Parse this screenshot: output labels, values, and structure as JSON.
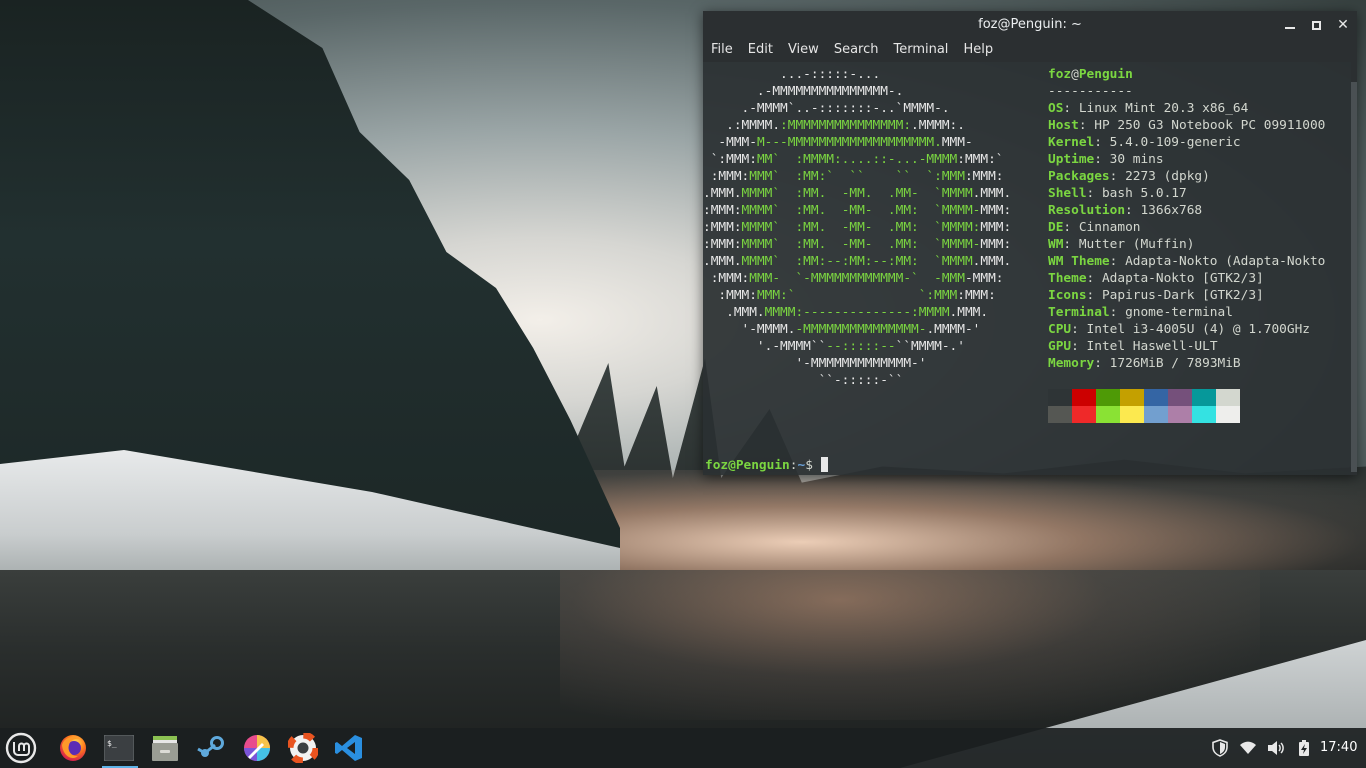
{
  "window": {
    "title": "foz@Penguin: ~",
    "menu": [
      "File",
      "Edit",
      "View",
      "Search",
      "Terminal",
      "Help"
    ]
  },
  "neofetch": {
    "header_user": "foz",
    "header_at": "@",
    "header_host": "Penguin",
    "separator": "-----------",
    "logo_lines": [
      [
        [
          "w",
          "          ...-:::::-..."
        ]
      ],
      [
        [
          "w",
          "       .-MMMMMMMMMMMMMMM-."
        ]
      ],
      [
        [
          "w",
          "     .-MMMM`..-:::::::-..`MMMM-."
        ]
      ],
      [
        [
          "w",
          "   .:MMMM."
        ],
        [
          "g",
          ":MMMMMMMMMMMMMMM:"
        ],
        [
          "w",
          ".MMMM:."
        ]
      ],
      [
        [
          "w",
          "  -MMM-"
        ],
        [
          "g",
          "M---MMMMMMMMMMMMMMMMMMM."
        ],
        [
          "w",
          "MMM-"
        ]
      ],
      [
        [
          "w",
          " `:MMM:"
        ],
        [
          "g",
          "MM`  :MMMM:....::-...-MMMM"
        ],
        [
          "w",
          ":MMM:`"
        ]
      ],
      [
        [
          "w",
          " :MMM:"
        ],
        [
          "g",
          "MMM`  :MM:`  ``    ``  `:MMM"
        ],
        [
          "w",
          ":MMM:"
        ]
      ],
      [
        [
          "w",
          ".MMM."
        ],
        [
          "g",
          "MMMM`  :MM.  -MM.  .MM-  `MMMM"
        ],
        [
          "w",
          ".MMM."
        ]
      ],
      [
        [
          "w",
          ":MMM:"
        ],
        [
          "g",
          "MMMM`  :MM.  -MM-  .MM:  `MMMM-"
        ],
        [
          "w",
          "MMM:"
        ]
      ],
      [
        [
          "w",
          ":MMM:"
        ],
        [
          "g",
          "MMMM`  :MM.  -MM-  .MM:  `MMMM:"
        ],
        [
          "w",
          "MMM:"
        ]
      ],
      [
        [
          "w",
          ":MMM:"
        ],
        [
          "g",
          "MMMM`  :MM.  -MM-  .MM:  `MMMM-"
        ],
        [
          "w",
          "MMM:"
        ]
      ],
      [
        [
          "w",
          ".MMM."
        ],
        [
          "g",
          "MMMM`  :MM:--:MM:--:MM:  `MMMM"
        ],
        [
          "w",
          ".MMM."
        ]
      ],
      [
        [
          "w",
          " :MMM:"
        ],
        [
          "g",
          "MMM-  `-MMMMMMMMMMMM-`  -MMM"
        ],
        [
          "w",
          "-MMM:"
        ]
      ],
      [
        [
          "w",
          "  :MMM:"
        ],
        [
          "g",
          "MMM:`                `:MMM"
        ],
        [
          "w",
          ":MMM:"
        ]
      ],
      [
        [
          "w",
          "   .MMM."
        ],
        [
          "g",
          "MMMM:--------------:MMMM"
        ],
        [
          "w",
          ".MMM."
        ]
      ],
      [
        [
          "w",
          "     '-MMMM."
        ],
        [
          "g",
          "-MMMMMMMMMMMMMMM-"
        ],
        [
          "w",
          ".MMMM-'"
        ]
      ],
      [
        [
          "w",
          "       '.-MMMM``"
        ],
        [
          "g",
          "--:::::--"
        ],
        [
          "w",
          "``MMMM-.'"
        ]
      ],
      [
        [
          "w",
          "            '-MMMMMMMMMMMMM-'"
        ]
      ],
      [
        [
          "w",
          "               ``-:::::-``"
        ]
      ]
    ],
    "info": [
      {
        "key": "OS",
        "value": "Linux Mint 20.3 x86_64"
      },
      {
        "key": "Host",
        "value": "HP 250 G3 Notebook PC 09911000"
      },
      {
        "key": "Kernel",
        "value": "5.4.0-109-generic"
      },
      {
        "key": "Uptime",
        "value": "30 mins"
      },
      {
        "key": "Packages",
        "value": "2273 (dpkg)"
      },
      {
        "key": "Shell",
        "value": "bash 5.0.17"
      },
      {
        "key": "Resolution",
        "value": "1366x768"
      },
      {
        "key": "DE",
        "value": "Cinnamon"
      },
      {
        "key": "WM",
        "value": "Mutter (Muffin)"
      },
      {
        "key": "WM Theme",
        "value": "Adapta-Nokto (Adapta-Nokto"
      },
      {
        "key": "Theme",
        "value": "Adapta-Nokto [GTK2/3]"
      },
      {
        "key": "Icons",
        "value": "Papirus-Dark [GTK2/3]"
      },
      {
        "key": "Terminal",
        "value": "gnome-terminal"
      },
      {
        "key": "CPU",
        "value": "Intel i3-4005U (4) @ 1.700GHz"
      },
      {
        "key": "GPU",
        "value": "Intel Haswell-ULT"
      },
      {
        "key": "Memory",
        "value": "1726MiB / 7893MiB"
      }
    ],
    "palette_top": [
      "#2e3436",
      "#cc0000",
      "#4e9a06",
      "#c4a000",
      "#3465a4",
      "#75507b",
      "#06989a",
      "#d3d7cf"
    ],
    "palette_bottom": [
      "#555753",
      "#ef2929",
      "#8ae234",
      "#fce94f",
      "#729fcf",
      "#ad7fa8",
      "#34e2e2",
      "#eeeeec"
    ]
  },
  "prompt": {
    "user_host": "foz@Penguin",
    "sep": ":",
    "path": "~",
    "symbol": "$ "
  },
  "taskbar": {
    "launchers": [
      "linux-mint-menu-icon",
      "firefox-icon",
      "terminal-icon",
      "files-icon",
      "steam-icon",
      "color-picker-icon",
      "help-icon",
      "vscode-icon"
    ],
    "clock": "17:40"
  },
  "colors": {
    "accent_green": "#7bd641",
    "path_blue": "#6aa0d8",
    "active_indicator": "#5fb4e8"
  }
}
